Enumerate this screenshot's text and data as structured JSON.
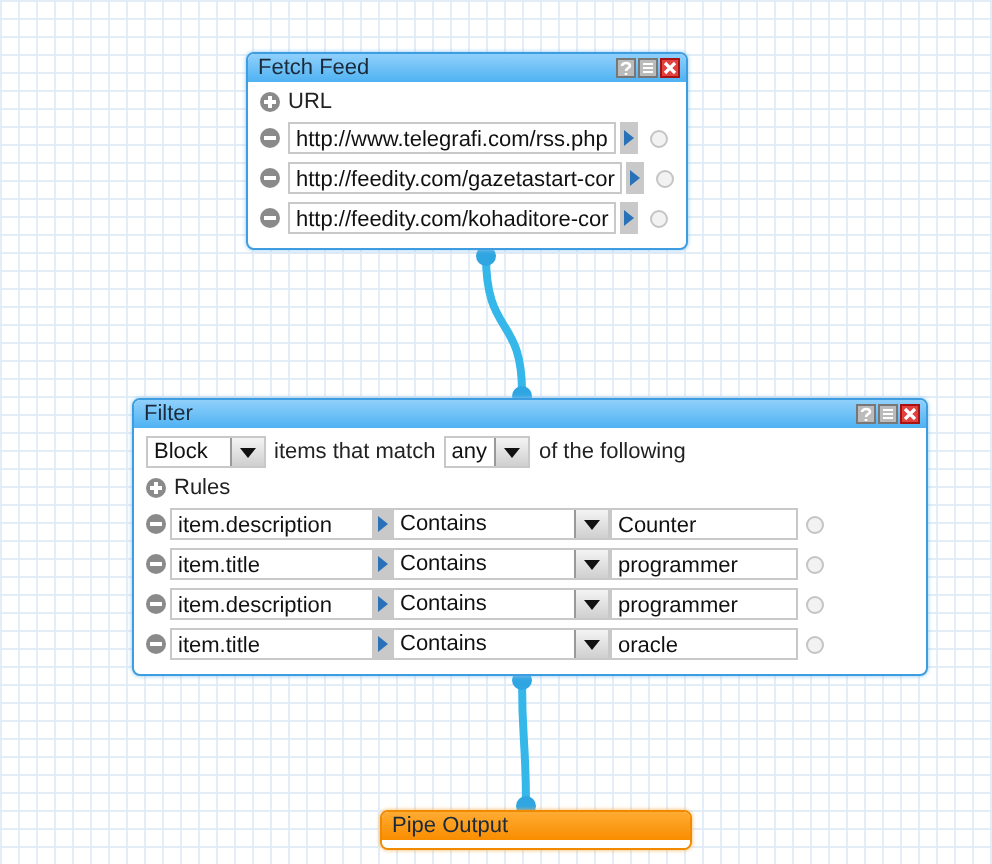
{
  "fetch_feed": {
    "title": "Fetch Feed",
    "add_label": "URL",
    "urls": [
      "http://www.telegrafi.com/rss.php",
      "http://feedity.com/gazetastart-cor",
      "http://feedity.com/kohaditore-cor"
    ]
  },
  "filter": {
    "title": "Filter",
    "mode": "Block",
    "middle_text": "items that match",
    "match": "any",
    "end_text": "of the following",
    "add_label": "Rules",
    "rules": [
      {
        "field": "item.description",
        "operator": "Contains",
        "value": "Counter"
      },
      {
        "field": "item.title",
        "operator": "Contains",
        "value": "programmer"
      },
      {
        "field": "item.description",
        "operator": "Contains",
        "value": "programmer"
      },
      {
        "field": "item.title",
        "operator": "Contains",
        "value": "oracle"
      }
    ]
  },
  "output": {
    "title": "Pipe Output"
  }
}
